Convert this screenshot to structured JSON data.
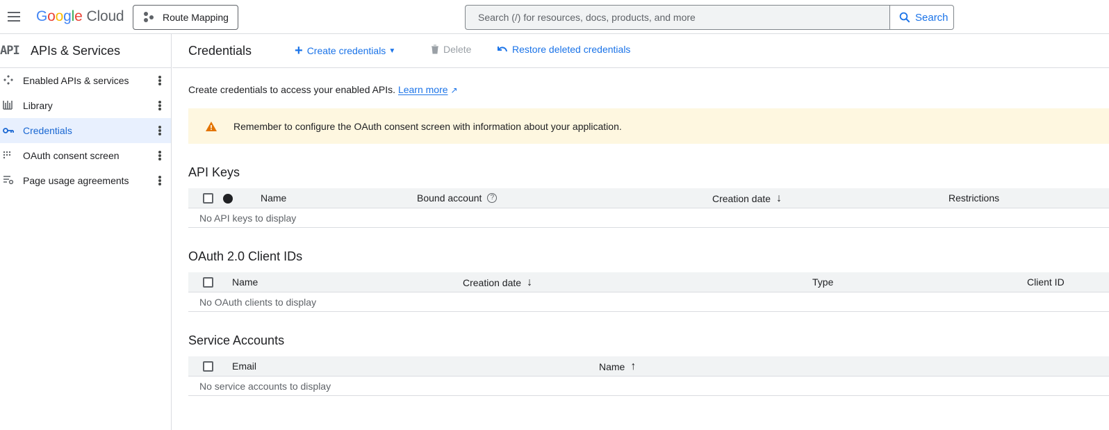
{
  "topbar": {
    "logo_google": [
      "G",
      "o",
      "o",
      "g",
      "l",
      "e"
    ],
    "logo_cloud": "Cloud",
    "project_label": "Route Mapping",
    "search_placeholder": "Search (/) for resources, docs, products, and more",
    "search_button": "Search"
  },
  "sidebar": {
    "title": "APIs & Services",
    "api_glyph": "API",
    "items": [
      {
        "label": "Enabled APIs & services",
        "icon": "enabled-apis-icon",
        "active": false
      },
      {
        "label": "Library",
        "icon": "library-icon",
        "active": false
      },
      {
        "label": "Credentials",
        "icon": "key-icon",
        "active": true
      },
      {
        "label": "OAuth consent screen",
        "icon": "oauth-icon",
        "active": false
      },
      {
        "label": "Page usage agreements",
        "icon": "agreements-icon",
        "active": false
      }
    ]
  },
  "toolbar": {
    "title": "Credentials",
    "create_label": "Create credentials",
    "delete_label": "Delete",
    "restore_label": "Restore deleted credentials"
  },
  "intro": {
    "text": "Create credentials to access your enabled APIs.",
    "learn_more": "Learn more"
  },
  "banner": {
    "text": "Remember to configure the OAuth consent screen with information about your application."
  },
  "api_keys": {
    "title": "API Keys",
    "columns": [
      "Name",
      "Bound account",
      "Creation date",
      "Restrictions"
    ],
    "empty": "No API keys to display"
  },
  "oauth_clients": {
    "title": "OAuth 2.0 Client IDs",
    "columns": [
      "Name",
      "Creation date",
      "Type",
      "Client ID"
    ],
    "empty": "No OAuth clients to display"
  },
  "service_accounts": {
    "title": "Service Accounts",
    "columns": [
      "Email",
      "Name"
    ],
    "empty": "No service accounts to display"
  },
  "colors": {
    "accent": "#1a73e8",
    "active_bg": "#e8f0fe",
    "banner_bg": "#fef7e0",
    "warning": "#e37400"
  }
}
